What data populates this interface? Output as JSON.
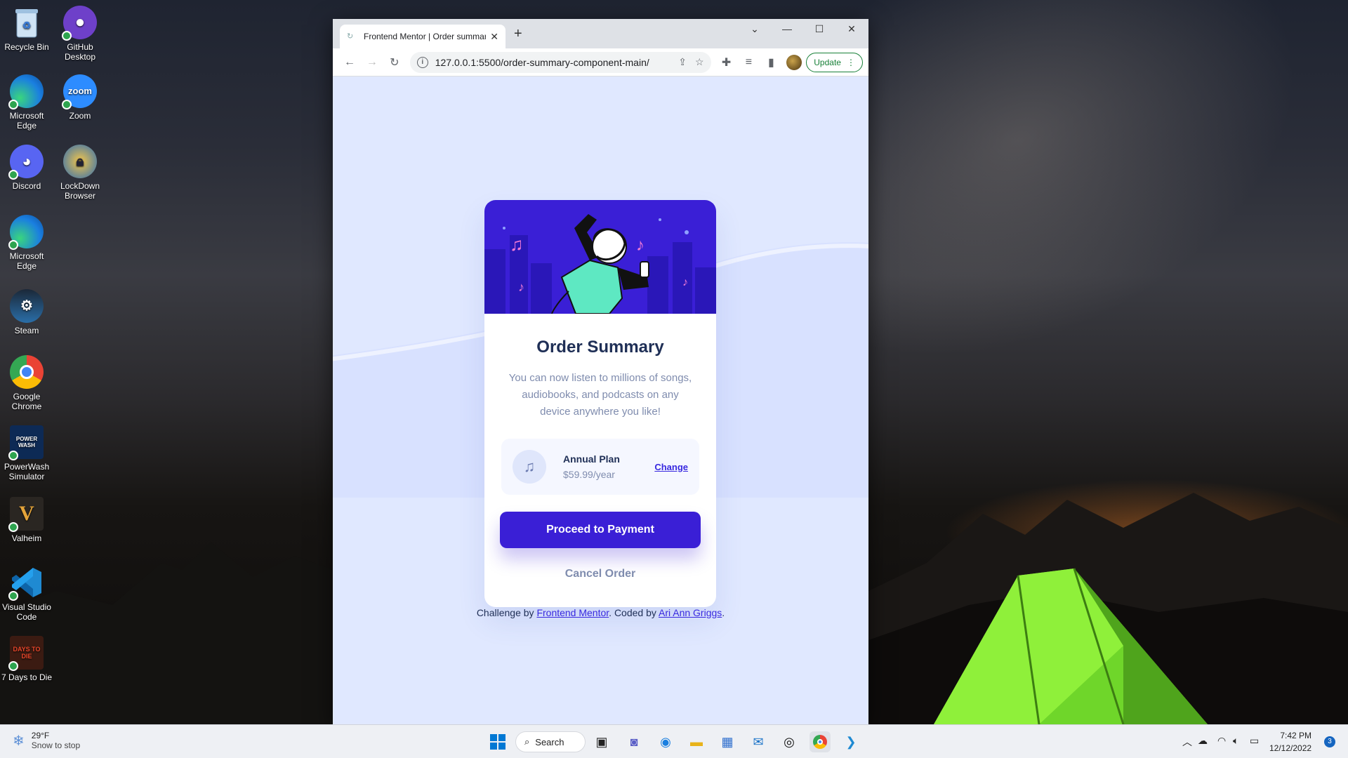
{
  "desktop": {
    "icons": [
      {
        "label": "Recycle Bin",
        "icon": "recycle-bin-icon"
      },
      {
        "label": "GitHub Desktop",
        "icon": "github-desktop-icon"
      },
      {
        "label": "Microsoft Edge",
        "icon": "edge-icon"
      },
      {
        "label": "Zoom",
        "icon": "zoom-icon",
        "glyph": "zoom"
      },
      {
        "label": "Discord",
        "icon": "discord-icon"
      },
      {
        "label": "LockDown Browser",
        "icon": "lockdown-browser-icon"
      },
      {
        "label": "Microsoft Edge",
        "icon": "edge-icon"
      },
      {
        "label": "Steam",
        "icon": "steam-icon"
      },
      {
        "label": "Google Chrome",
        "icon": "chrome-icon"
      },
      {
        "label": "PowerWash Simulator",
        "icon": "powerwash-icon",
        "glyph": "POWER WASH"
      },
      {
        "label": "Valheim",
        "icon": "valheim-icon",
        "glyph": "V"
      },
      {
        "label": "Visual Studio Code",
        "icon": "vscode-icon"
      },
      {
        "label": "7 Days to Die",
        "icon": "seven-days-icon",
        "glyph": "DAYS TO DIE"
      }
    ]
  },
  "browser": {
    "tab_title": "Frontend Mentor | Order summary",
    "url": "127.0.0.1:5500/order-summary-component-main/",
    "update_label": "Update"
  },
  "card": {
    "title": "Order Summary",
    "description": "You can now listen to millions of songs, audiobooks, and podcasts on any device anywhere you like!",
    "plan_name": "Annual Plan",
    "plan_price": "$59.99/year",
    "change_label": "Change",
    "pay_label": "Proceed to Payment",
    "cancel_label": "Cancel Order"
  },
  "attribution": {
    "prefix": "Challenge by",
    "link1": "Frontend Mentor",
    "middle": ". Coded by",
    "link2": "Ari Ann Griggs",
    "suffix": "."
  },
  "taskbar": {
    "temperature": "29°F",
    "weather_text": "Snow to stop",
    "search_label": "Search",
    "time": "7:42 PM",
    "date": "12/12/2022",
    "notification_count": "3"
  },
  "colors": {
    "accent": "#3829e0",
    "hero": "#3a1fd6",
    "page_bg": "#e0e8ff",
    "title": "#1f2f56",
    "muted": "#7f8cae"
  }
}
